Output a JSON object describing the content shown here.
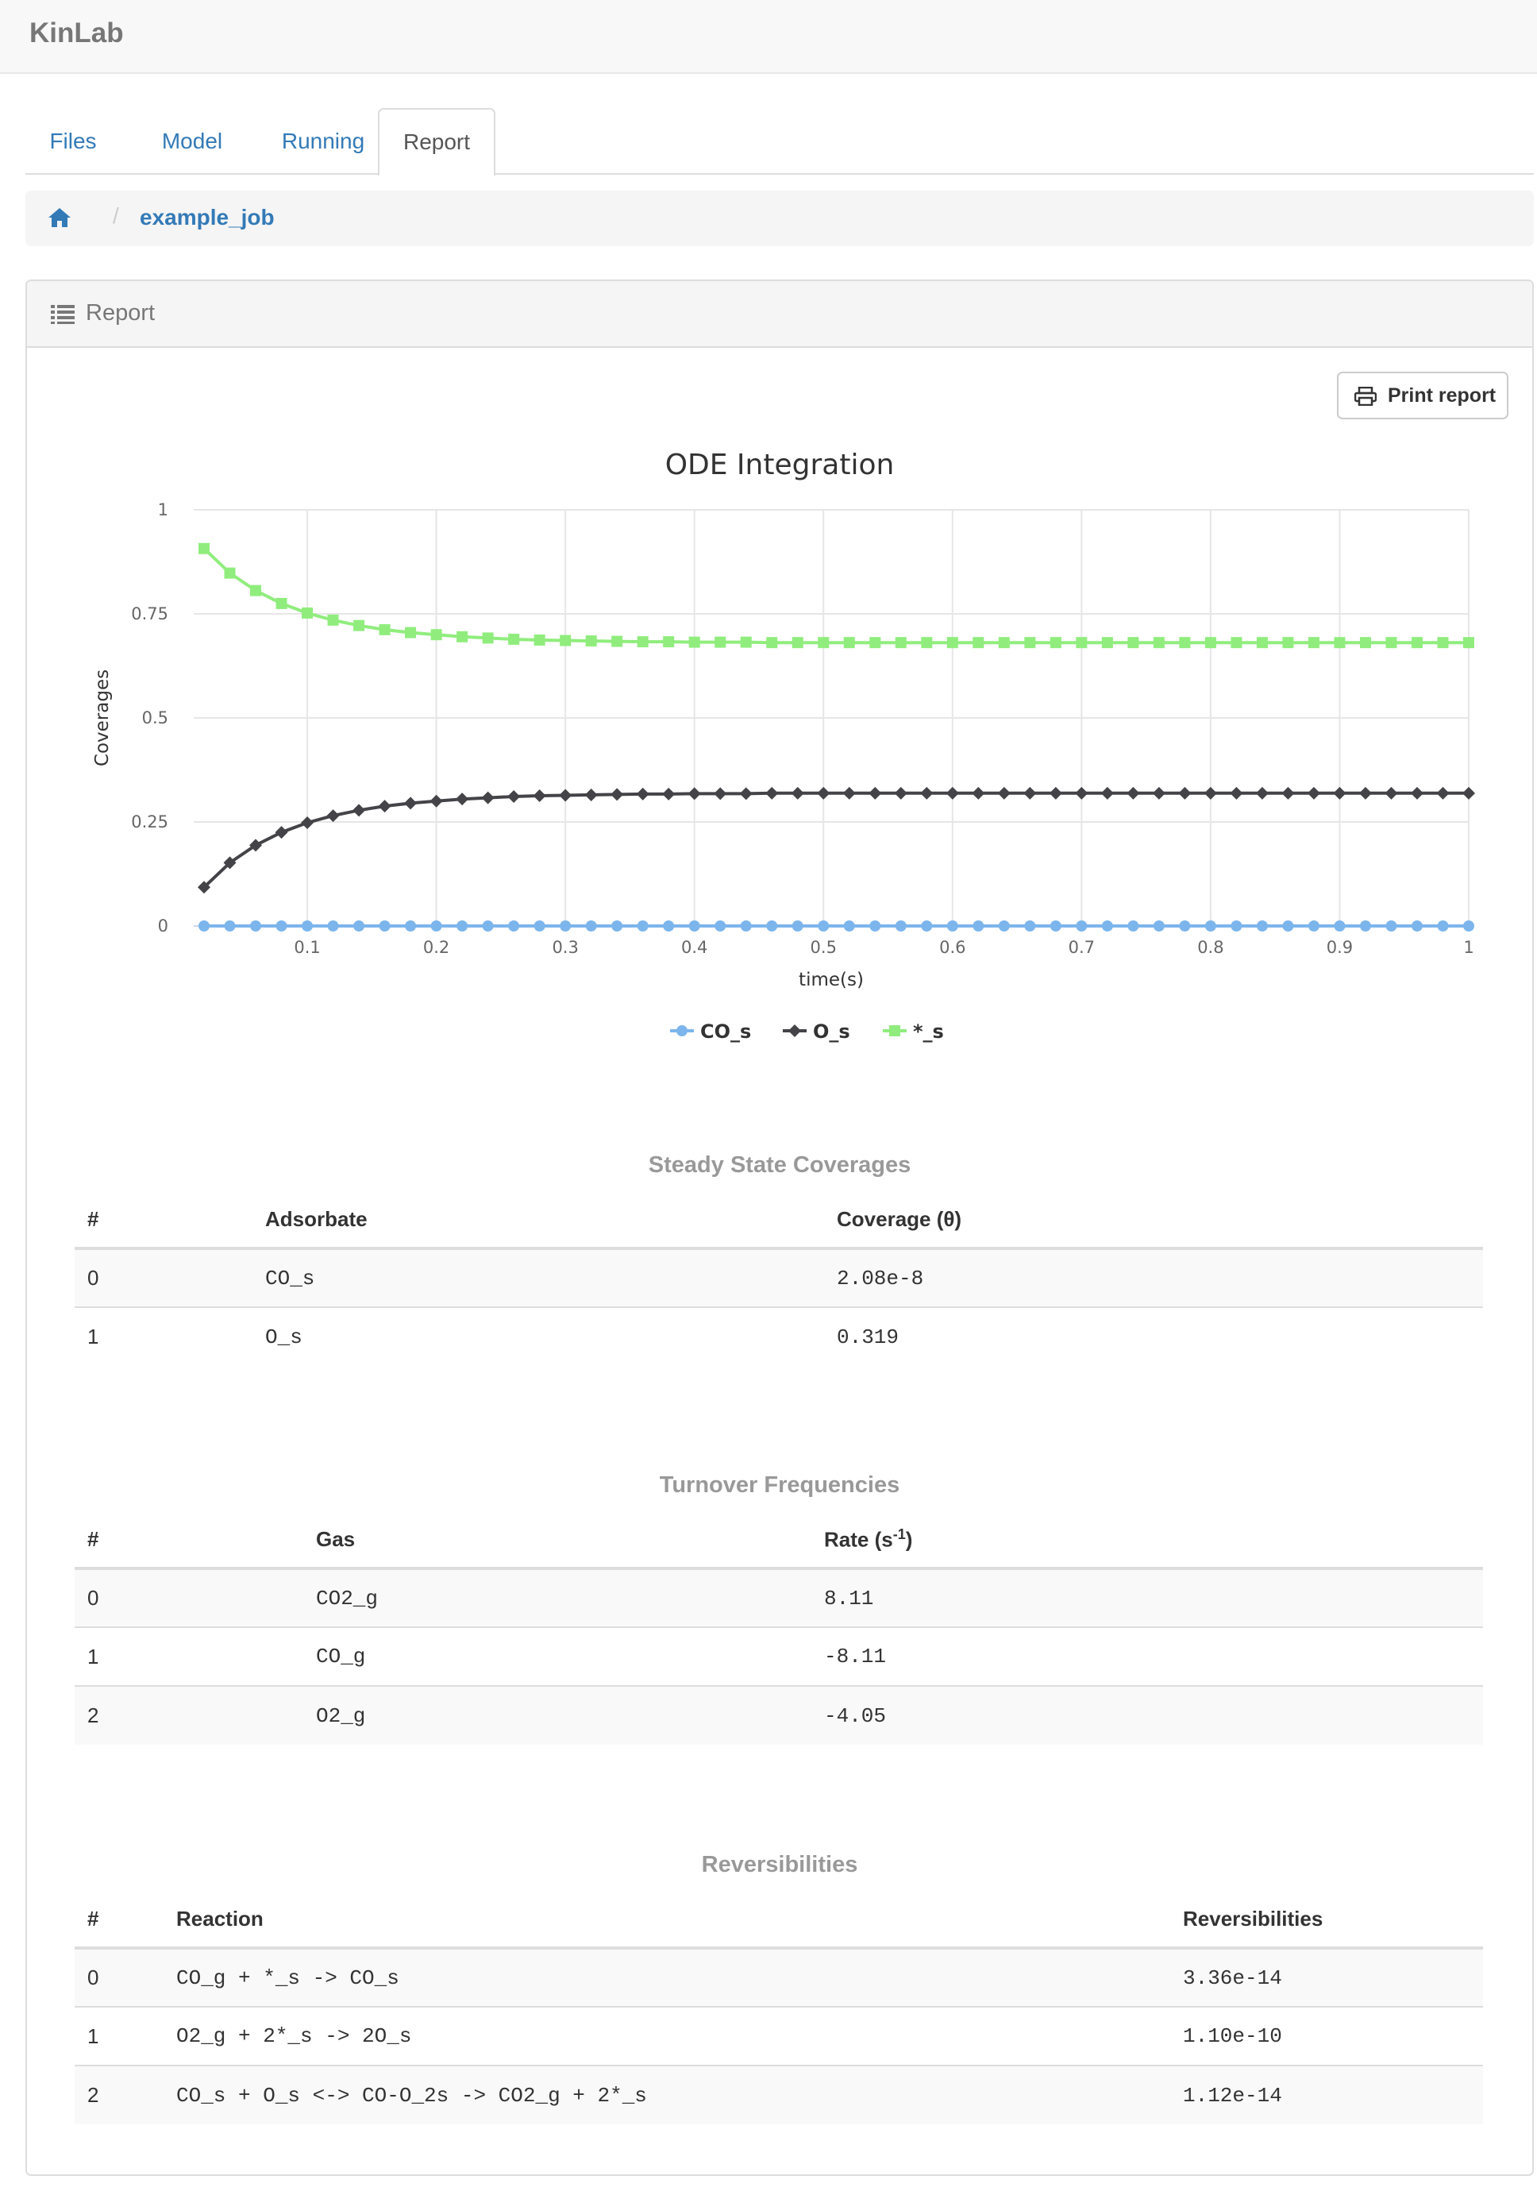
{
  "app": {
    "title": "KinLab"
  },
  "tabs": [
    {
      "label": "Files"
    },
    {
      "label": "Model"
    },
    {
      "label": "Running"
    },
    {
      "label": "Report",
      "active": true
    }
  ],
  "breadcrumb": {
    "home_icon": "home-icon",
    "current": "example_job"
  },
  "panel": {
    "title": "Report",
    "icon": "list-icon"
  },
  "print_button": {
    "label": "Print report",
    "icon": "print-icon"
  },
  "colors": {
    "link": "#337ab7",
    "co_s": "#7cb5ec",
    "o_s": "#434348",
    "star_s": "#90ed7d"
  },
  "chart_data": {
    "type": "line",
    "title": "ODE Integration",
    "xlabel": "time(s)",
    "ylabel": "Coverages",
    "xlim": [
      0.012,
      1.0
    ],
    "ylim": [
      0,
      1
    ],
    "x_ticks": [
      "0.1",
      "0.2",
      "0.3",
      "0.4",
      "0.5",
      "0.6",
      "0.7",
      "0.8",
      "0.9",
      "1"
    ],
    "y_ticks": [
      "0",
      "0.25",
      "0.5",
      "0.75",
      "1"
    ],
    "grid": true,
    "legend_position": "bottom-center",
    "x": [
      0.02,
      0.04,
      0.06,
      0.08,
      0.1,
      0.12,
      0.14,
      0.16,
      0.18,
      0.2,
      0.22,
      0.24,
      0.26,
      0.28,
      0.3,
      0.32,
      0.34,
      0.36,
      0.38,
      0.4,
      0.42,
      0.44,
      0.46,
      0.48,
      0.5,
      0.52,
      0.54,
      0.56,
      0.58,
      0.6,
      0.62,
      0.64,
      0.66,
      0.68,
      0.7,
      0.72,
      0.74,
      0.76,
      0.78,
      0.8,
      0.82,
      0.84,
      0.86,
      0.88,
      0.9,
      0.92,
      0.94,
      0.96,
      0.98,
      1.0
    ],
    "series": [
      {
        "name": "CO_s",
        "marker": "circle",
        "values": [
          0,
          0,
          0,
          0,
          0,
          0,
          0,
          0,
          0,
          0,
          0,
          0,
          0,
          0,
          0,
          0,
          0,
          0,
          0,
          0,
          0,
          0,
          0,
          0,
          0,
          0,
          0,
          0,
          0,
          0,
          0,
          0,
          0,
          0,
          0,
          0,
          0,
          0,
          0,
          0,
          0,
          0,
          0,
          0,
          0,
          0,
          0,
          0,
          0,
          0
        ]
      },
      {
        "name": "O_s",
        "marker": "diamond",
        "values": [
          0.093,
          0.152,
          0.194,
          0.225,
          0.248,
          0.265,
          0.278,
          0.288,
          0.295,
          0.3,
          0.305,
          0.308,
          0.311,
          0.313,
          0.314,
          0.315,
          0.316,
          0.317,
          0.317,
          0.318,
          0.318,
          0.318,
          0.319,
          0.319,
          0.319,
          0.319,
          0.319,
          0.319,
          0.319,
          0.319,
          0.319,
          0.319,
          0.319,
          0.319,
          0.319,
          0.319,
          0.319,
          0.319,
          0.319,
          0.319,
          0.319,
          0.319,
          0.319,
          0.319,
          0.319,
          0.319,
          0.319,
          0.319,
          0.319,
          0.319
        ]
      },
      {
        "name": "*_s",
        "marker": "square",
        "values": [
          0.907,
          0.848,
          0.806,
          0.775,
          0.752,
          0.735,
          0.722,
          0.712,
          0.705,
          0.7,
          0.695,
          0.692,
          0.689,
          0.687,
          0.686,
          0.685,
          0.684,
          0.683,
          0.683,
          0.682,
          0.682,
          0.682,
          0.681,
          0.681,
          0.681,
          0.681,
          0.681,
          0.681,
          0.681,
          0.681,
          0.681,
          0.681,
          0.681,
          0.681,
          0.681,
          0.681,
          0.681,
          0.681,
          0.681,
          0.681,
          0.681,
          0.681,
          0.681,
          0.681,
          0.681,
          0.681,
          0.681,
          0.681,
          0.681,
          0.681
        ]
      }
    ]
  },
  "steady_state": {
    "title": "Steady State Coverages",
    "headers": [
      "#",
      "Adsorbate",
      "Coverage (θ)"
    ],
    "rows": [
      [
        "0",
        "CO_s",
        "2.08e-8"
      ],
      [
        "1",
        "O_s",
        "0.319"
      ]
    ]
  },
  "tof": {
    "title": "Turnover Frequencies",
    "headers": [
      "#",
      "Gas",
      "Rate (s",
      "-1",
      ")"
    ],
    "rows": [
      [
        "0",
        "CO2_g",
        "8.11"
      ],
      [
        "1",
        "CO_g",
        "-8.11"
      ],
      [
        "2",
        "O2_g",
        "-4.05"
      ]
    ]
  },
  "reversibilities": {
    "title": "Reversibilities",
    "headers": [
      "#",
      "Reaction",
      "Reversibilities"
    ],
    "rows": [
      [
        "0",
        "CO_g + *_s -> CO_s",
        "3.36e-14"
      ],
      [
        "1",
        "O2_g + 2*_s -> 2O_s",
        "1.10e-10"
      ],
      [
        "2",
        "CO_s + O_s <-> CO-O_2s -> CO2_g + 2*_s",
        "1.12e-14"
      ]
    ]
  }
}
